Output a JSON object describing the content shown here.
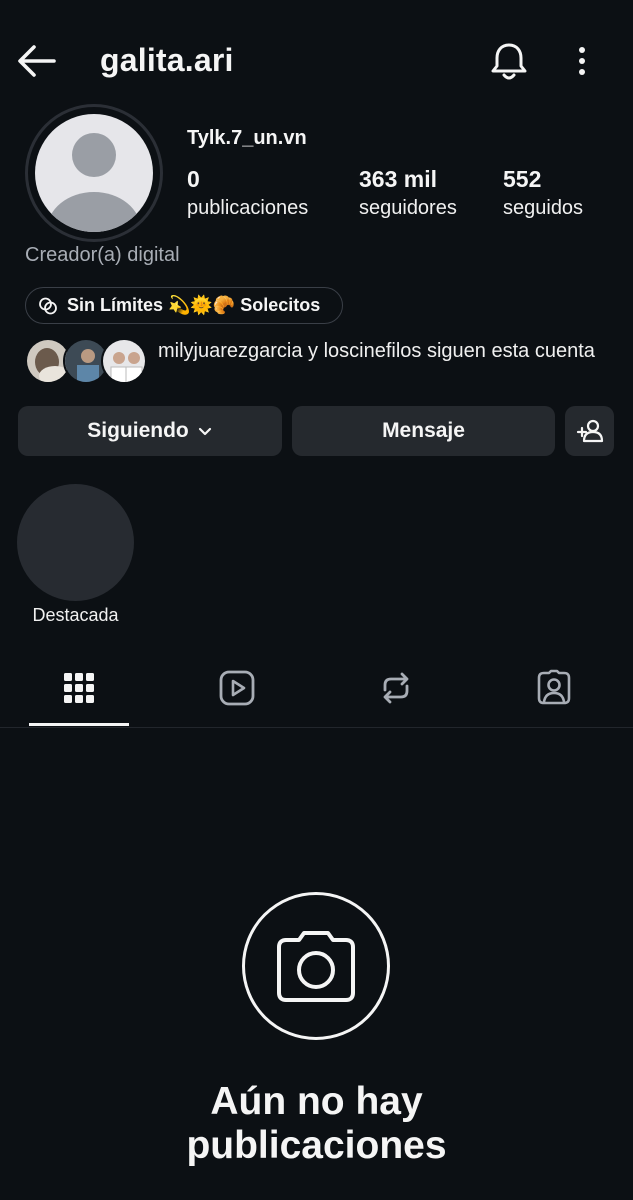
{
  "header": {
    "username": "galita.ari"
  },
  "profile": {
    "display_name": "Tylk.7_un.vn",
    "category": "Creador(a) digital",
    "stats": [
      {
        "value": "0",
        "label": "publicaciones"
      },
      {
        "value": "363 mil",
        "label": "seguidores"
      },
      {
        "value": "552",
        "label": "seguidos"
      }
    ],
    "threads_badge": "Sin Límites 💫🌞🥐 Solecitos",
    "followed_by": "milyjuarezgarcia y loscinefilos siguen esta cuenta"
  },
  "actions": {
    "following": "Siguiendo",
    "message": "Mensaje"
  },
  "highlights": [
    {
      "label": "Destacada"
    }
  ],
  "tabs": [
    "grid-icon",
    "reels-icon",
    "reposts-icon",
    "tagged-icon"
  ],
  "empty_state": {
    "title": "Aún no hay publicaciones"
  },
  "colors": {
    "background": "#0c1014",
    "button": "#25292e",
    "muted_text": "#a8adb5"
  }
}
